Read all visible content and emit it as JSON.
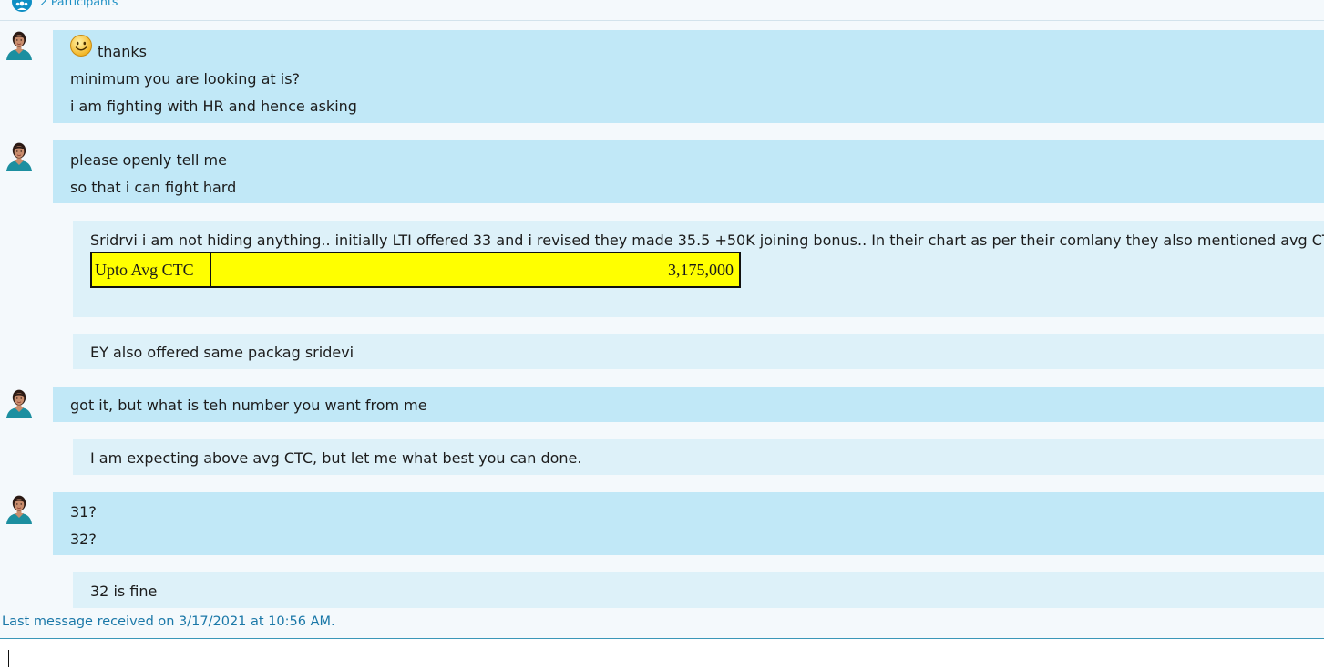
{
  "header": {
    "participants_label": "2 Participants",
    "participants_icon": "participants-icon"
  },
  "colors": {
    "incoming_bubble": "#c1e8f7",
    "outgoing_bubble": "#ddf1f9",
    "accent": "#1b8fc4",
    "table_highlight": "#ffff00"
  },
  "messages": [
    {
      "direction": "incoming",
      "emoticon": "smiley-emoticon",
      "lines": [
        "thanks",
        "minimum you are looking at is?",
        "i am fighting with HR and hence asking"
      ]
    },
    {
      "direction": "incoming",
      "lines": [
        "please openly tell me",
        "so that i can fight hard"
      ]
    },
    {
      "direction": "outgoing",
      "lines": [
        "Sridrvi i am not hiding anything.. initially LTI offered 33 and i revised they made 35.5 +50K joining bonus..  In their chart as per their comlany they also mentioned avg CTC"
      ],
      "table": {
        "label": "Upto Avg CTC",
        "value": "3,175,000"
      }
    },
    {
      "direction": "outgoing",
      "lines": [
        "EY also offered same packag sridevi"
      ]
    },
    {
      "direction": "incoming",
      "lines": [
        "got it, but what is teh number you want from me"
      ]
    },
    {
      "direction": "outgoing",
      "lines": [
        "I am expecting above avg CTC, but let me what best you can done."
      ]
    },
    {
      "direction": "incoming",
      "lines": [
        "31?",
        "32?"
      ]
    },
    {
      "direction": "outgoing",
      "lines": [
        "32 is fine"
      ]
    }
  ],
  "status": {
    "last_message": "Last message received on 3/17/2021 at 10:56 AM."
  },
  "composer": {
    "value": ""
  }
}
